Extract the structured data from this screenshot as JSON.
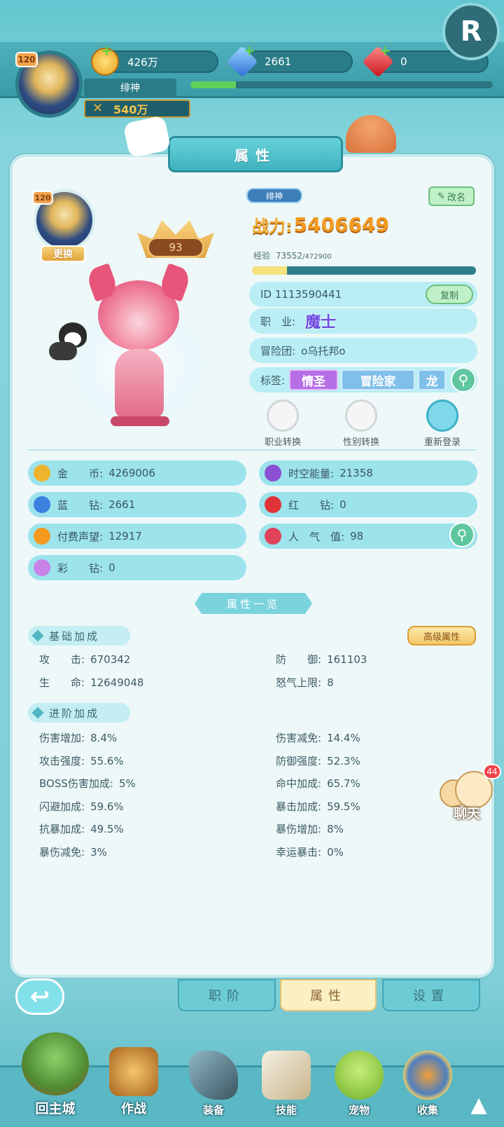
{
  "header": {
    "level": "120",
    "name": "绯神",
    "power_short": "540万",
    "gold": "426万",
    "blue_diamond": "2661",
    "red_diamond": "0",
    "r_badge": "R"
  },
  "panel": {
    "title": "属性",
    "avatar_level": "120",
    "change_btn": "更换",
    "rank_badge": "93",
    "name_tag": "绯神",
    "rename_btn": "改名",
    "power_label": "战力:",
    "power_value": "5406649",
    "exp_label": "经验",
    "exp_value": "73552",
    "exp_max": "/472900",
    "exp_progress": 0.156,
    "id_text": "ID 1113590441",
    "copy_btn": "复制",
    "job_label": "职　业:",
    "job_value": "魔士",
    "guild_label": "冒险团:",
    "guild_value": "o乌托邦o",
    "tags_label": "标签:",
    "tags": [
      "情圣",
      "冒险家",
      "龙"
    ],
    "actions": [
      "职业转换",
      "性别转换",
      "重新登录"
    ]
  },
  "currencies": [
    {
      "label": "金　　币:",
      "value": "4269006",
      "icon": "gold-coin-icon",
      "color": "#f0b32c"
    },
    {
      "label": "时空能量:",
      "value": "21358",
      "icon": "spacetime-crystal-icon",
      "color": "#8a4fd3"
    },
    {
      "label": "蓝　　钻:",
      "value": "2661",
      "icon": "blue-diamond-icon",
      "color": "#3d82e0"
    },
    {
      "label": "红　　钻:",
      "value": "0",
      "icon": "red-diamond-icon",
      "color": "#e0343a"
    },
    {
      "label": "付费声望:",
      "value": "12917",
      "icon": "prestige-icon",
      "color": "#f39a1e"
    },
    {
      "label": "人　气　值:",
      "value": "98",
      "icon": "popularity-heart-icon",
      "color": "#e0435a"
    },
    {
      "label": "彩　　钻:",
      "value": "0",
      "icon": "rainbow-diamond-icon",
      "color": "#c882e8"
    }
  ],
  "overview": {
    "title": "属性一览",
    "basic_title": "基础加成",
    "advanced_btn": "高级属性",
    "basic": [
      {
        "label": "攻　　击:",
        "value": "670342"
      },
      {
        "label": "防　　御:",
        "value": "161103"
      },
      {
        "label": "生　　命:",
        "value": "12649048"
      },
      {
        "label": "怒气上限:",
        "value": "8"
      }
    ],
    "adv_title": "进阶加成",
    "advanced": [
      {
        "label": "伤害增加:",
        "value": "8.4%"
      },
      {
        "label": "伤害减免:",
        "value": "14.4%"
      },
      {
        "label": "攻击强度:",
        "value": "55.6%"
      },
      {
        "label": "防御强度:",
        "value": "52.3%"
      },
      {
        "label": "BOSS伤害加成:",
        "value": "5%"
      },
      {
        "label": "命中加成:",
        "value": "65.7%"
      },
      {
        "label": "闪避加成:",
        "value": "59.6%"
      },
      {
        "label": "暴击加成:",
        "value": "59.5%"
      },
      {
        "label": "抗暴加成:",
        "value": "49.5%"
      },
      {
        "label": "暴伤增加:",
        "value": "8%"
      },
      {
        "label": "暴伤减免:",
        "value": "3%"
      },
      {
        "label": "幸运暴击:",
        "value": "0%"
      }
    ]
  },
  "chat": {
    "label": "聊天",
    "badge": "44"
  },
  "bottom_tabs": [
    "职阶",
    "属性",
    "设置"
  ],
  "nav": [
    "回主城",
    "作战",
    "装备",
    "技能",
    "宠物",
    "收集"
  ]
}
